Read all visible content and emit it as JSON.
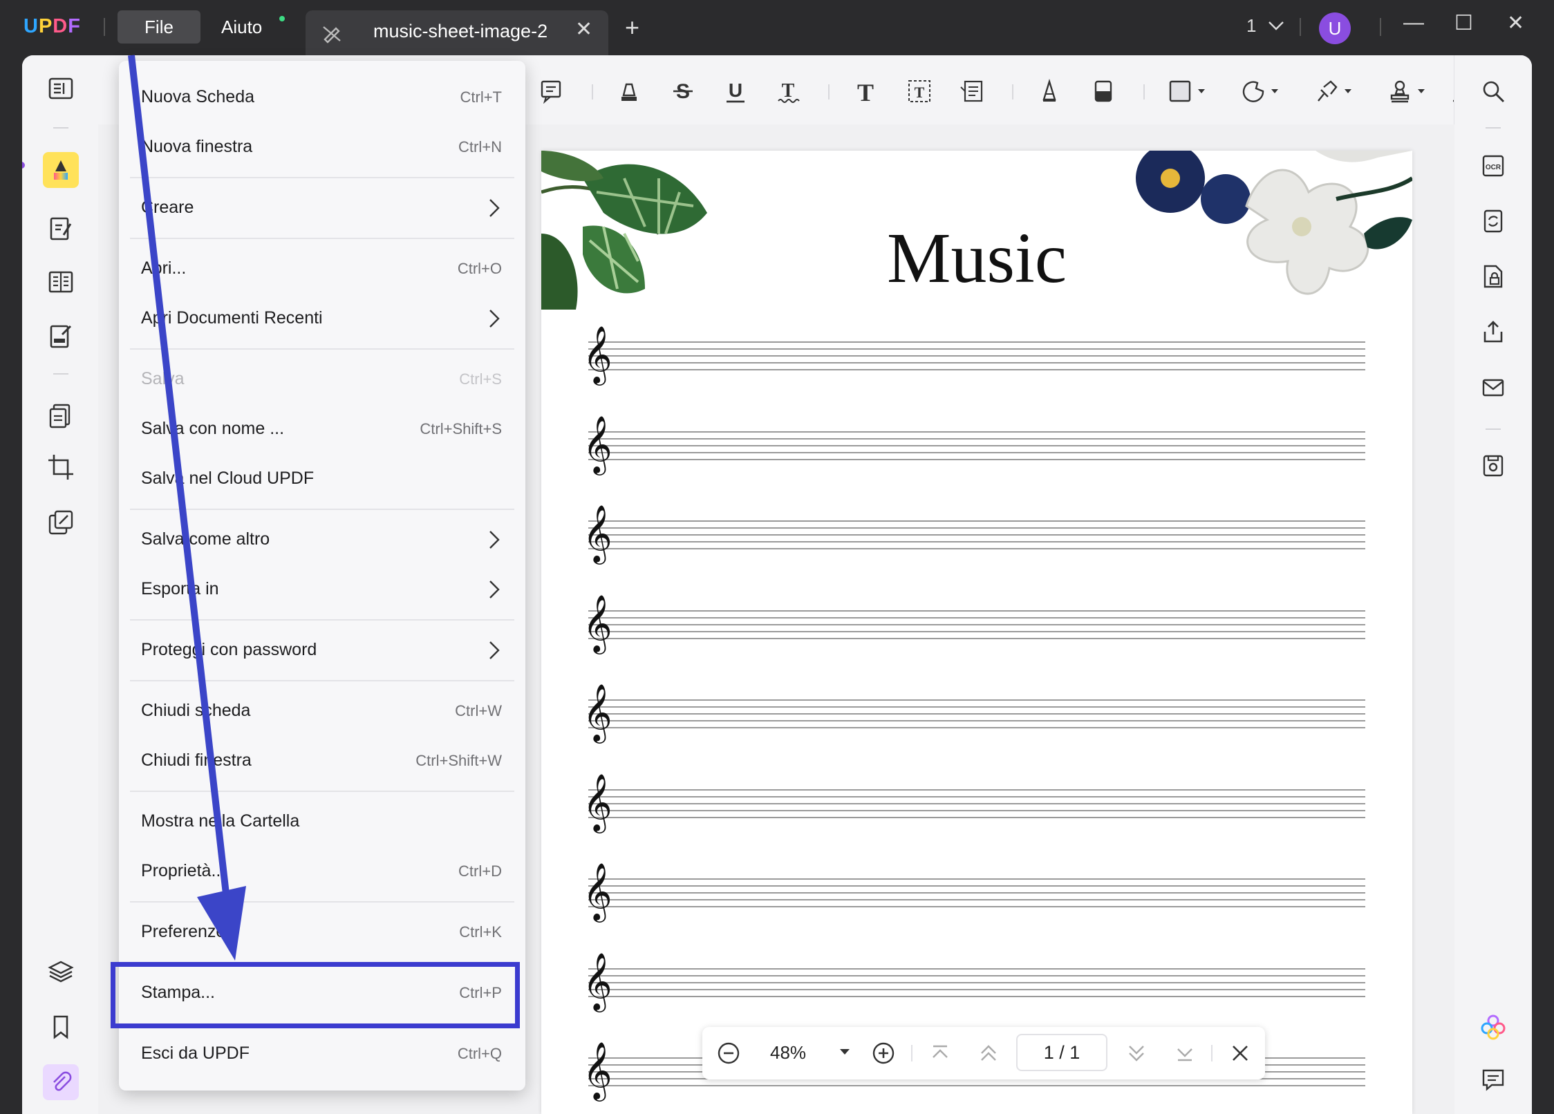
{
  "app": {
    "logo": "UPDF"
  },
  "menubar": {
    "file": "File",
    "help": "Aiuto"
  },
  "tab": {
    "title": "music-sheet-image-2",
    "close": "✕",
    "add": "+"
  },
  "header_right": {
    "page_count": "1",
    "avatar_letter": "U"
  },
  "window_controls": {
    "minimize": "—",
    "maximize": "☐",
    "close": "✕"
  },
  "file_menu": {
    "items": [
      {
        "label": "Nuova Scheda",
        "shortcut": "Ctrl+T"
      },
      {
        "label": "Nuova finestra",
        "shortcut": "Ctrl+N"
      },
      {
        "label": "Creare",
        "submenu": true
      },
      {
        "label": "Apri...",
        "shortcut": "Ctrl+O"
      },
      {
        "label": "Apri Documenti Recenti",
        "submenu": true
      },
      {
        "label": "Salva",
        "shortcut": "Ctrl+S",
        "disabled": true
      },
      {
        "label": "Salva con nome ...",
        "shortcut": "Ctrl+Shift+S"
      },
      {
        "label": "Salva nel Cloud UPDF"
      },
      {
        "label": "Salva come altro",
        "submenu": true
      },
      {
        "label": "Esporta in",
        "submenu": true
      },
      {
        "label": "Proteggi con password",
        "submenu": true
      },
      {
        "label": "Chiudi scheda",
        "shortcut": "Ctrl+W"
      },
      {
        "label": "Chiudi finestra",
        "shortcut": "Ctrl+Shift+W"
      },
      {
        "label": "Mostra nella Cartella"
      },
      {
        "label": "Proprietà...",
        "shortcut": "Ctrl+D"
      },
      {
        "label": "Preferenze...",
        "shortcut": "Ctrl+K"
      },
      {
        "label": "Stampa...",
        "shortcut": "Ctrl+P",
        "highlighted": true
      },
      {
        "label": "Esci da UPDF",
        "shortcut": "Ctrl+Q"
      }
    ]
  },
  "document": {
    "title": "Music",
    "clef": "𝄞"
  },
  "zoombar": {
    "zoom": "48%",
    "page_display": "1 / 1"
  },
  "colors": {
    "highlight": "#3b3bcf",
    "arrow": "#3b45c8",
    "active_tool": "#ffe25a",
    "avatar": "#8a4de0"
  }
}
